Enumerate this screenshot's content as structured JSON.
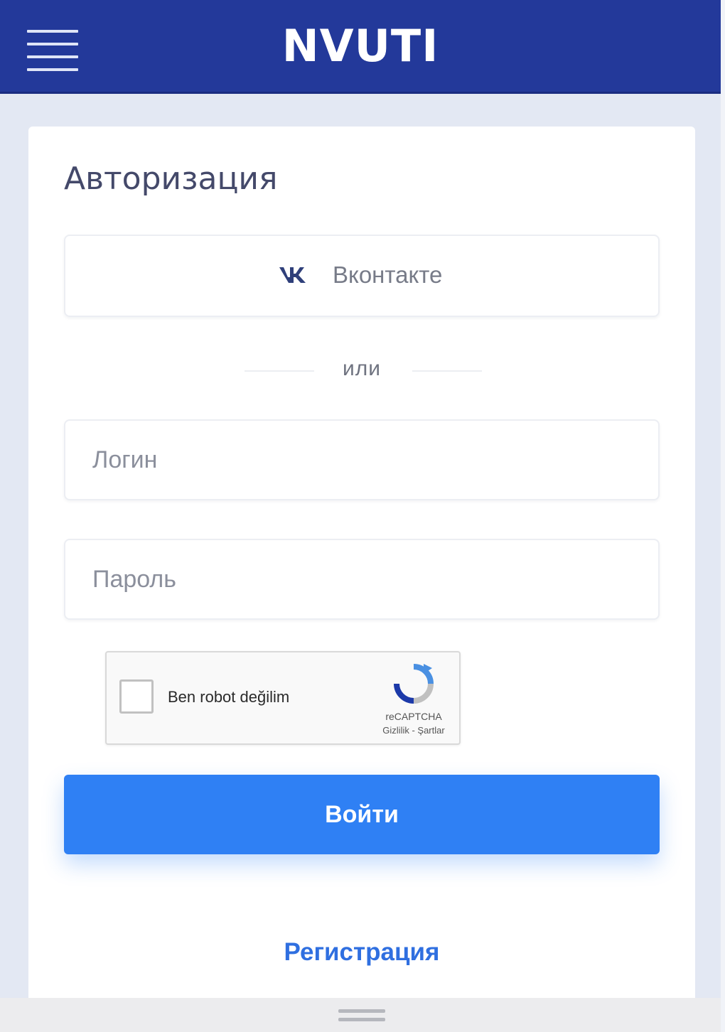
{
  "header": {
    "logo_text": "NVUTI",
    "menu_icon": "hamburger-menu-icon",
    "background_color": "#23399a"
  },
  "auth": {
    "title": "Авторизация",
    "vk_button": {
      "icon": "vk-icon",
      "label": "Вконтакте"
    },
    "divider_text": "или",
    "login_field": {
      "placeholder": "Логин",
      "value": ""
    },
    "password_field": {
      "placeholder": "Пароль",
      "value": ""
    },
    "recaptcha": {
      "label": "Ben robot değilim",
      "brand": "reCAPTCHA",
      "links": "Gizlilik - Şartlar",
      "icon": "recaptcha-logo-icon",
      "checked": false
    },
    "submit_label": "Войти",
    "register_label": "Регистрация",
    "accent_color": "#2f80f4"
  }
}
